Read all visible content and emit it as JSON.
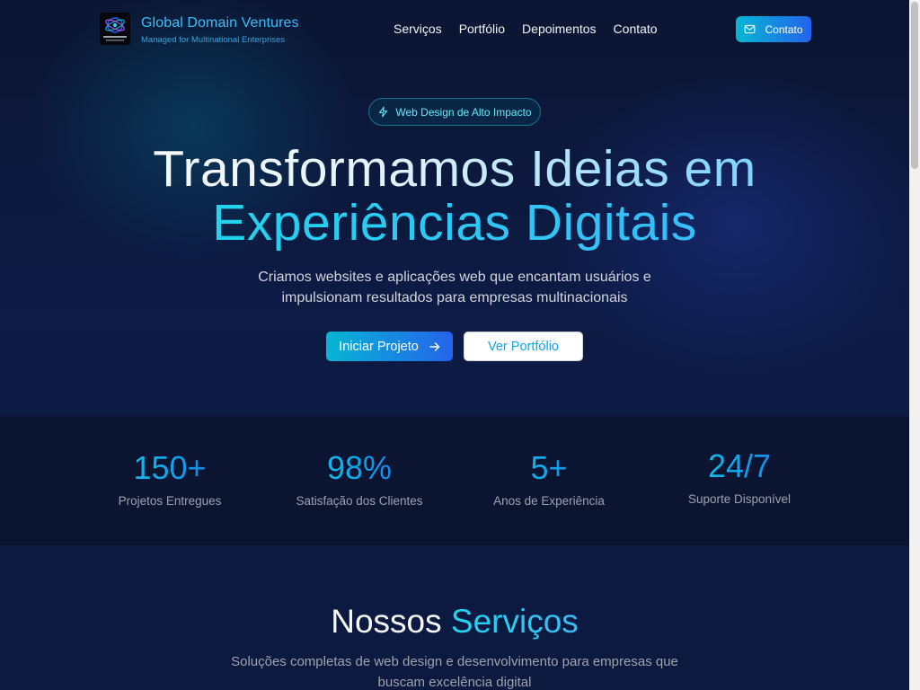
{
  "header": {
    "brand_name": "Global Domain Ventures",
    "brand_tagline": "Managed for Multinational Enterprises",
    "nav": [
      "Serviços",
      "Portfólio",
      "Depoimentos",
      "Contato"
    ],
    "cta_label": "Contato"
  },
  "hero": {
    "badge": "Web Design de Alto Impacto",
    "title_line1": "Transformamos Ideias em",
    "title_line2": "Experiências Digitais",
    "subtitle": "Criamos websites e aplicações web que encantam usuários e impulsionam resultados para empresas multinacionais",
    "primary_button": "Iniciar Projeto",
    "secondary_button": "Ver Portfólio"
  },
  "stats": [
    {
      "value": "150+",
      "label": "Projetos Entregues"
    },
    {
      "value": "98%",
      "label": "Satisfação dos Clientes"
    },
    {
      "value": "5+",
      "label": "Anos de Experiência"
    },
    {
      "value": "24/7",
      "label": "Suporte Disponível"
    }
  ],
  "services": {
    "title_part1": "Nossos",
    "title_part2": "Serviços",
    "subtitle": "Soluções completas de web design e desenvolvimento para empresas que buscam excelência digital"
  },
  "icons": {
    "header_cta": "mail-icon",
    "badge": "lightning-icon",
    "primary_button": "arrow-right-icon"
  },
  "colors": {
    "accent": "#22d3ee",
    "primary_gradient_start": "#06b6d4",
    "primary_gradient_end": "#2563eb",
    "background": "#0b1533"
  }
}
